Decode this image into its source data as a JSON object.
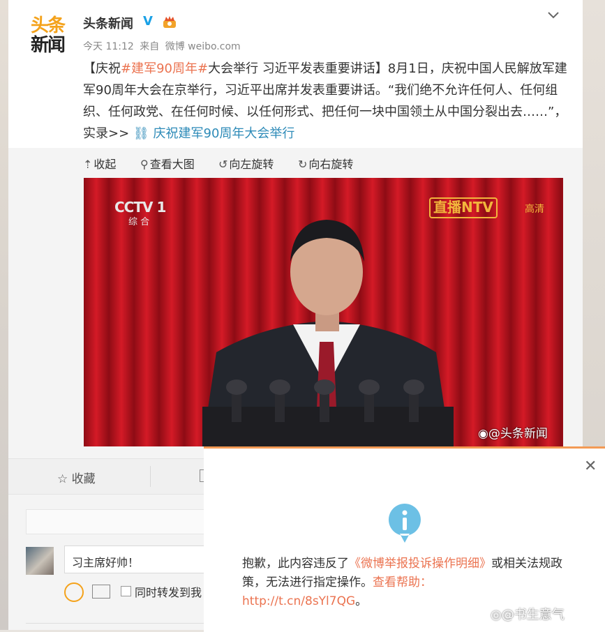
{
  "post": {
    "author": "头条新闻",
    "logo_line1": "头条",
    "logo_line2": "新闻",
    "time": "今天 11:12",
    "source_prefix": "来自",
    "source": "微博 weibo.com",
    "text_part1": "【庆祝",
    "topic": "#建军90周年#",
    "text_part2": "大会举行 习近平发表重要讲话】8月1日，庆祝中国人民解放军建军90周年大会在京举行，习近平出席并发表重要讲话。“我们绝不允许任何人、任何组织、任何政党、在任何时候、以任何形式、把任何一块中国领土从中国分裂出去……”，实录>>",
    "link_text": "庆祝建军90周年大会举行"
  },
  "image_toolbar": {
    "collapse": "收起",
    "view_large": "查看大图",
    "rotate_left": "向左旋转",
    "rotate_right": "向右旋转"
  },
  "photo": {
    "channel": "CCTV 1",
    "channel_sub": "综 合",
    "live": "直播",
    "ntv": "NTV",
    "hd": "高清",
    "weibo_watermark": "@头条新闻"
  },
  "actions": {
    "favorite": "收藏"
  },
  "comment": {
    "value": "习主席好帅！",
    "repost_label": "同时转发到我"
  },
  "dialog": {
    "msg_part1": "抱歉，此内容违反了",
    "rule_link": "《微博举报投诉操作明细》",
    "msg_part2": "或相关法规政策，无法进行指定操作。",
    "help": "查看帮助：",
    "url": "http://t.cn/8sYl7QG",
    "end": "。"
  },
  "watermark": "@书生意气",
  "colors": {
    "accent": "#eb7350",
    "link_blue": "#2e8bb8",
    "dialog_border": "#f39a55",
    "info_icon": "#6cc0e5"
  }
}
